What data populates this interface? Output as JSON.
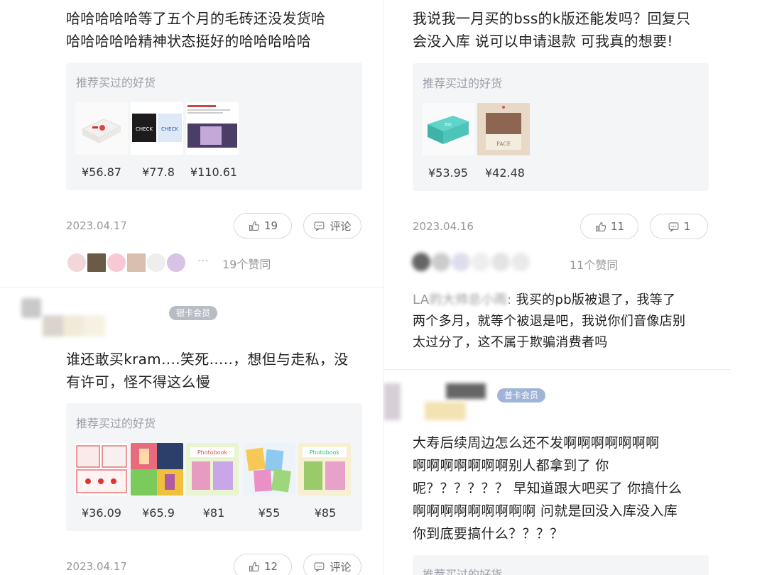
{
  "left": {
    "post1": {
      "text_line1": "哈哈哈哈哈等了五个月的毛砖还没发货哈",
      "text_line2": "哈哈哈哈哈精神状态挺好的哈哈哈哈哈",
      "card_title": "推荐买过的好货",
      "prices": [
        "¥56.87",
        "¥77.8",
        "¥110.61"
      ],
      "date": "2023.04.17",
      "likes": "19",
      "comment_label": "评论",
      "agree_text": "19个赞同",
      "dots": "···"
    },
    "post2": {
      "badge": "银卡会员",
      "text_line1": "谁还敢买kram….笑死…..，想但与走私，没",
      "text_line2": "有许可，怪不得这么慢",
      "card_title": "推荐买过的好货",
      "prices": [
        "¥36.09",
        "¥65.9",
        "¥81",
        "¥55",
        "¥85"
      ],
      "date": "2023.04.17",
      "likes": "12",
      "comment_label": "评论"
    }
  },
  "right": {
    "post1": {
      "text_line1": "我说我一月买的bss的k版还能发吗？回复只",
      "text_line2": "会没入库 说可以申请退款 可我真的想要!",
      "card_title": "推荐买过的好货",
      "prices": [
        "¥53.95",
        "¥42.48"
      ],
      "date": "2023.04.16",
      "likes": "11",
      "comments": "1",
      "agree_text": "11个赞同"
    },
    "reply": {
      "user_prefix": "LA",
      "user_rest": "的大帅总小雨",
      "text_line1": "我买的pb版被退了，我等了",
      "text_line2": "两个多月，就等个被退是吧，我说你们音像店别",
      "text_line3": "太过分了，这不属于欺骗消费者吗"
    },
    "post2": {
      "badge": "普卡会员",
      "text_line1": "大寿后续周边怎么还不发啊啊啊啊啊啊啊",
      "text_line2": "啊啊啊啊啊啊啊别人都拿到了 你",
      "text_line3": "呢？？？？？？ 早知道跟大吧买了 你搞什么",
      "text_line4": "啊啊啊啊啊啊啊啊啊 问就是回没入库没入库",
      "text_line5": "你到底要搞什么？？？？",
      "card_title": "推荐买过的好货"
    }
  },
  "colors": {
    "card_bg": "#f4f5f7",
    "muted": "#999999",
    "badge_silver": "#b8bcc4",
    "badge_blue": "#9fb4d8"
  }
}
